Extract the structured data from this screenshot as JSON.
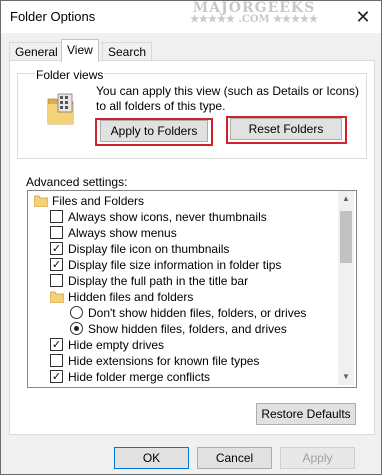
{
  "window": {
    "title": "Folder Options",
    "close_glyph": "✕"
  },
  "watermark": {
    "title": "MAJORGEEKS",
    "sub": "★★★★★ .COM ★★★★★"
  },
  "tabs": [
    {
      "label": "General",
      "active": false
    },
    {
      "label": "View",
      "active": true
    },
    {
      "label": "Search",
      "active": false
    }
  ],
  "folder_views": {
    "label": "Folder views",
    "description": "You can apply this view (such as Details or Icons) to all folders of this type.",
    "icon": "folder-views-icon",
    "apply_button": "Apply to Folders",
    "reset_button": "Reset Folders"
  },
  "advanced": {
    "label": "Advanced settings:",
    "items": [
      {
        "type": "folder",
        "label": "Files and Folders",
        "icon": "folder-icon"
      },
      {
        "type": "checkbox",
        "label": "Always show icons, never thumbnails",
        "checked": false
      },
      {
        "type": "checkbox",
        "label": "Always show menus",
        "checked": false
      },
      {
        "type": "checkbox",
        "label": "Display file icon on thumbnails",
        "checked": true
      },
      {
        "type": "checkbox",
        "label": "Display file size information in folder tips",
        "checked": true
      },
      {
        "type": "checkbox",
        "label": "Display the full path in the title bar",
        "checked": false
      },
      {
        "type": "folder",
        "label": "Hidden files and folders",
        "icon": "folder-icon"
      },
      {
        "type": "radio",
        "label": "Don't show hidden files, folders, or drives",
        "checked": false
      },
      {
        "type": "radio",
        "label": "Show hidden files, folders, and drives",
        "checked": true
      },
      {
        "type": "checkbox",
        "label": "Hide empty drives",
        "checked": true
      },
      {
        "type": "checkbox",
        "label": "Hide extensions for known file types",
        "checked": false
      },
      {
        "type": "checkbox",
        "label": "Hide folder merge conflicts",
        "checked": true
      }
    ],
    "check_glyph": "✓",
    "scroll_up_glyph": "▲",
    "scroll_down_glyph": "▼"
  },
  "restore_defaults_button": "Restore Defaults",
  "footer": {
    "ok": "OK",
    "cancel": "Cancel",
    "apply": "Apply"
  },
  "colors": {
    "highlight_red": "#d2222d",
    "folder_yellow": "#f4d27a",
    "disabled_text": "#a0a0a0"
  }
}
